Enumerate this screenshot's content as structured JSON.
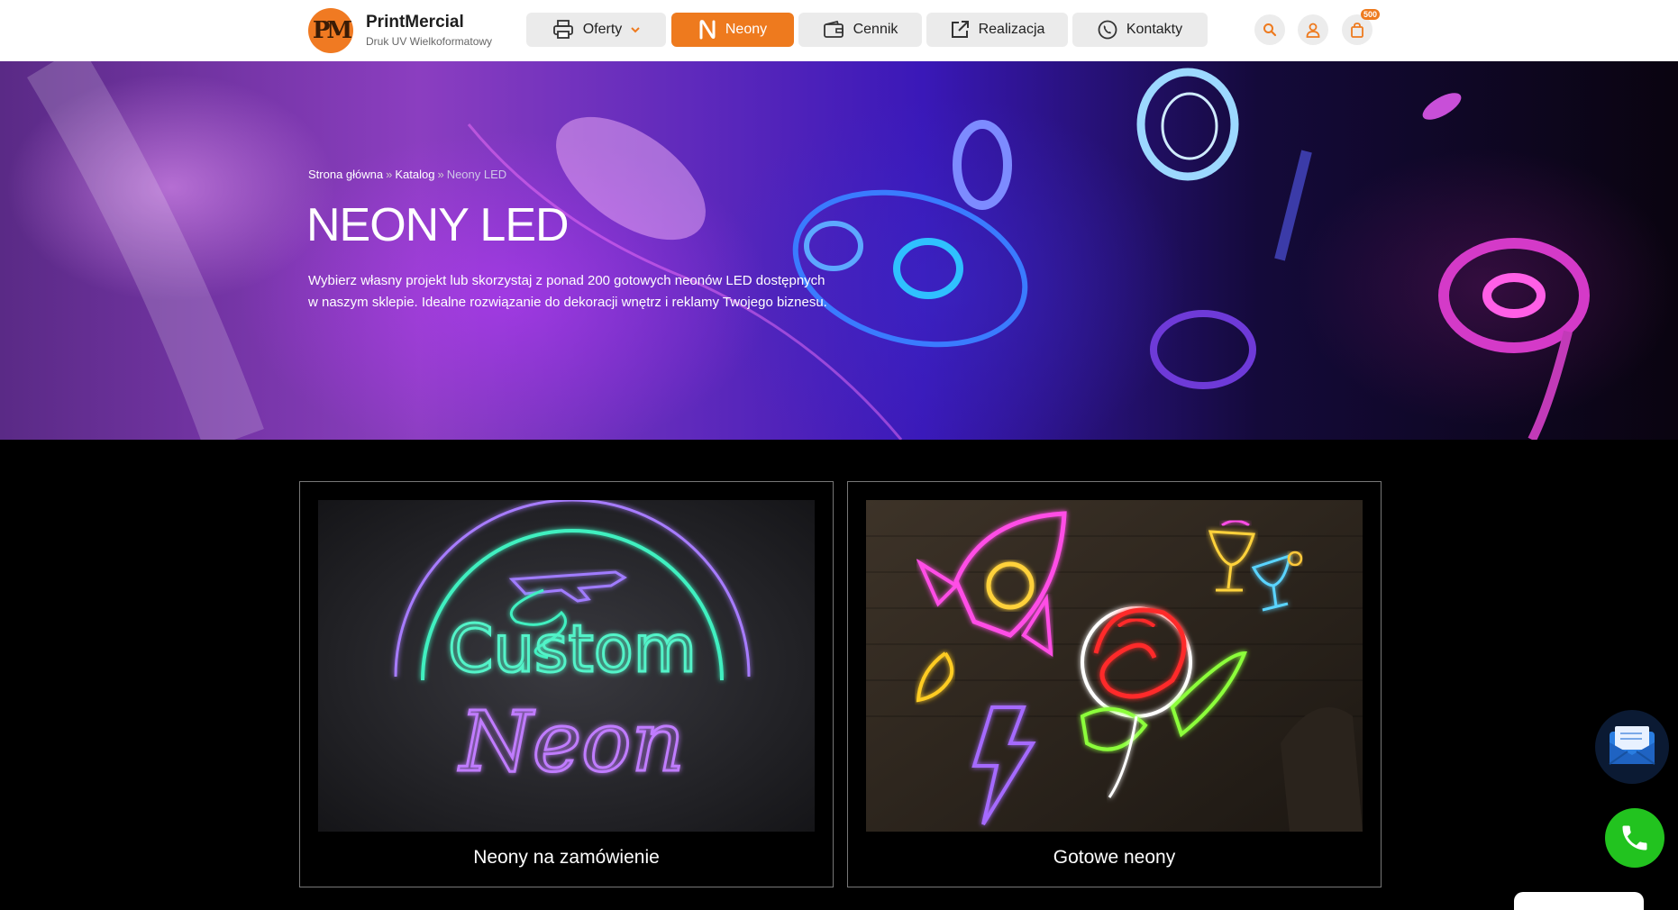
{
  "header": {
    "brand_title": "PrintMercial",
    "brand_subtitle": "Druk UV Wielkoformatowy",
    "nav": [
      {
        "label": "Oferty",
        "icon": "printer-icon",
        "dropdown": true
      },
      {
        "label": "Neony",
        "icon": "neon-n-icon",
        "active": true
      },
      {
        "label": "Cennik",
        "icon": "wallet-icon"
      },
      {
        "label": "Realizacja",
        "icon": "external-link-icon"
      },
      {
        "label": "Kontakty",
        "icon": "phone-icon"
      }
    ],
    "cart_badge": "500"
  },
  "hero": {
    "breadcrumb": {
      "home": "Strona główna",
      "separator": "»",
      "catalog": "Katalog",
      "current": "Neony LED"
    },
    "title": "NEONY LED",
    "description": "Wybierz własny projekt lub skorzystaj z ponad 200 gotowych neonów LED dostępnych w naszym sklepie. Idealne rozwiązanie do dekoracji wnętrz i reklamy Twojego biznesu."
  },
  "cards": [
    {
      "label": "Neony na zamówienie",
      "image_text_top": "Custom",
      "image_text_bottom": "Neon"
    },
    {
      "label": "Gotowe neony"
    }
  ],
  "colors": {
    "accent": "#ee7a1e",
    "nav_bg": "#ebebeb",
    "phone_button": "#22c31f"
  }
}
